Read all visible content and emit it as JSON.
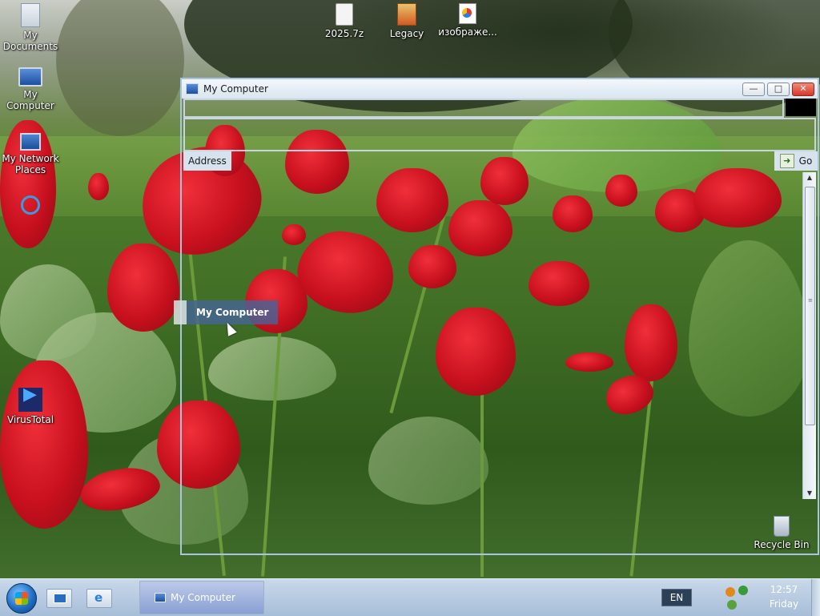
{
  "desktop": {
    "icons": [
      {
        "label": "My Documents"
      },
      {
        "label": "My Computer"
      },
      {
        "label": "My Network Places"
      },
      {
        "label": "VirusTotal"
      },
      {
        "label": "2025.7z"
      },
      {
        "label": "Legacy"
      },
      {
        "label": "изображе..."
      },
      {
        "label": "Recycle Bin"
      }
    ]
  },
  "window": {
    "title": "My Computer",
    "buttons": {
      "minimize": "—",
      "maximize": "□",
      "close": "✕"
    },
    "address_label": "Address",
    "go_label": "Go"
  },
  "drag": {
    "label": "My Computer"
  },
  "taskbar": {
    "task_button": "My Computer",
    "language": "EN",
    "time": "12:57",
    "day": "Friday"
  },
  "colors": {
    "window_border": "#a9c4de",
    "taskbar": "#b8cce0",
    "close_button": "#d8362a"
  }
}
